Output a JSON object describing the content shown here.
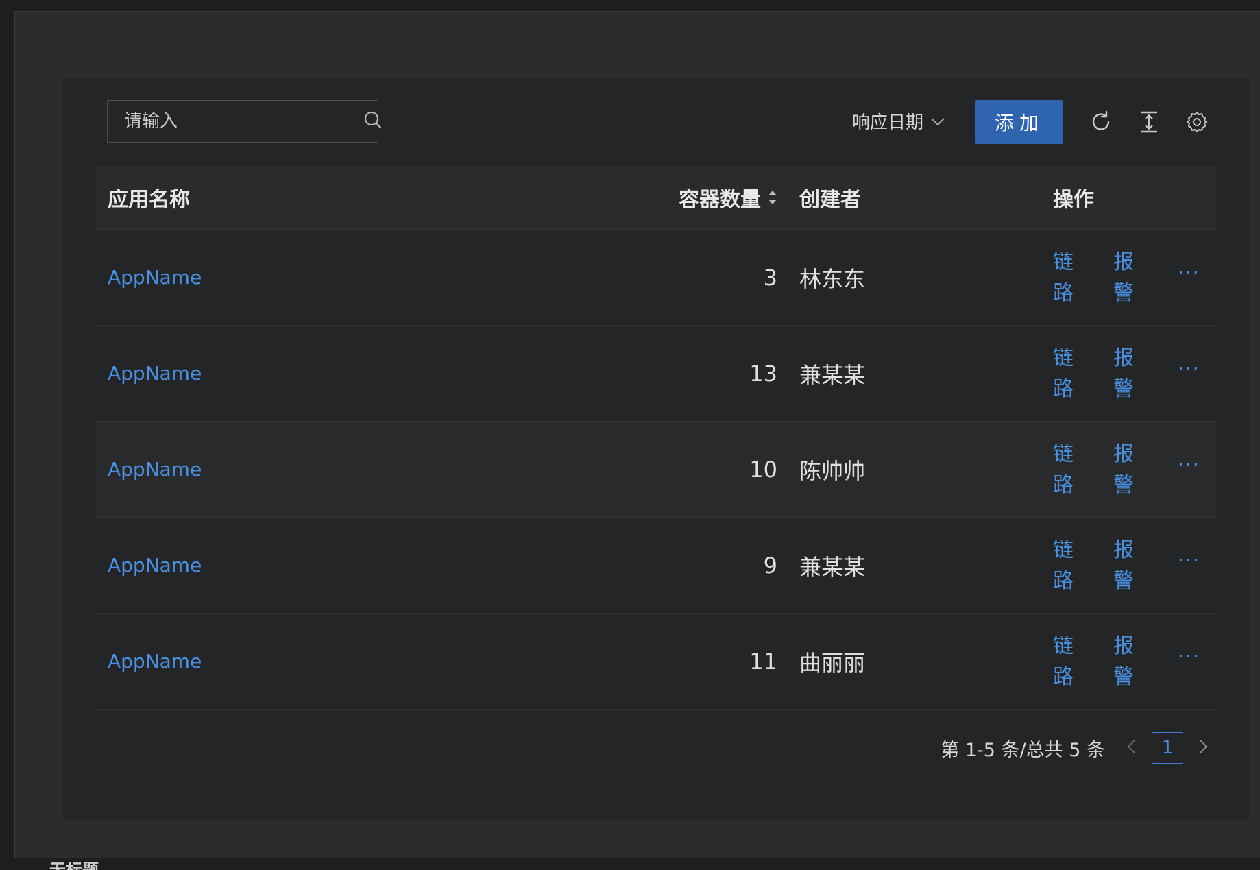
{
  "toolbar": {
    "search_placeholder": "请输入",
    "date_filter_label": "响应日期",
    "add_label": "添加"
  },
  "table": {
    "columns": [
      "应用名称",
      "容器数量",
      "创建者",
      "操作"
    ],
    "rows": [
      {
        "name": "AppName",
        "count": "3",
        "creator": "林东东",
        "op1": "链路",
        "op2": "报警",
        "more": "···"
      },
      {
        "name": "AppName",
        "count": "13",
        "creator": "兼某某",
        "op1": "链路",
        "op2": "报警",
        "more": "···"
      },
      {
        "name": "AppName",
        "count": "10",
        "creator": "陈帅帅",
        "op1": "链路",
        "op2": "报警",
        "more": "···"
      },
      {
        "name": "AppName",
        "count": "9",
        "creator": "兼某某",
        "op1": "链路",
        "op2": "报警",
        "more": "···"
      },
      {
        "name": "AppName",
        "count": "11",
        "creator": "曲丽丽",
        "op1": "链路",
        "op2": "报警",
        "more": "···"
      }
    ]
  },
  "pagination": {
    "summary": "第 1-5 条/总共 5 条",
    "current_page": "1"
  },
  "footer": {
    "cut_title": "无标题"
  },
  "colors": {
    "accent": "#2f65b0",
    "link": "#4a90e2",
    "background": "#242526"
  },
  "icons": [
    "search-icon",
    "chevron-down-icon",
    "reload-icon",
    "column-height-icon",
    "settings-icon",
    "sort-icon",
    "chevron-left-icon",
    "chevron-right-icon"
  ]
}
